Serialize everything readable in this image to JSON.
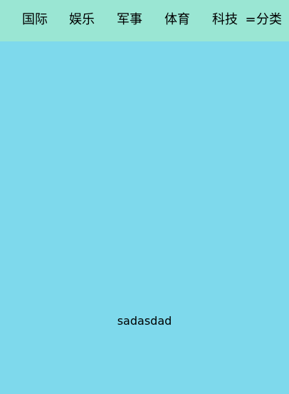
{
  "colors": {
    "tab_bar_background": "#9ae6d3",
    "content_background": "#7ed9ec",
    "text": "#000000"
  },
  "tabs": [
    {
      "label": "国际"
    },
    {
      "label": "娱乐"
    },
    {
      "label": "军事"
    },
    {
      "label": "体育"
    },
    {
      "label": "科技"
    }
  ],
  "category_button": {
    "icon": "menu-icon",
    "icon_glyph": "=",
    "label": "分类"
  },
  "content": {
    "text": "sadasdad"
  }
}
